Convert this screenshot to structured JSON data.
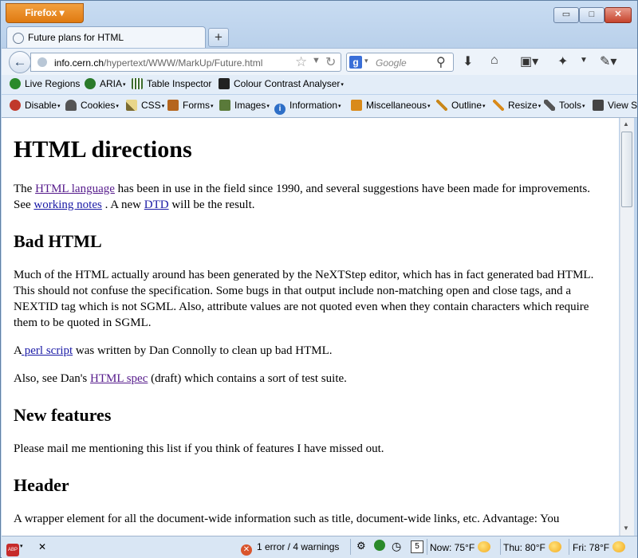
{
  "app": {
    "menu_label": "Firefox"
  },
  "window_controls": {
    "minimize": "▭",
    "maximize": "□",
    "close": "✕"
  },
  "tab": {
    "title": "Future plans for HTML",
    "new_tab": "+"
  },
  "navbar": {
    "url_host": "info.cern.ch",
    "url_path": "/hypertext/WWW/MarkUp/Future.html",
    "search_placeholder": "Google",
    "icons": [
      "back-icon",
      "star-icon",
      "reload-icon",
      "download-icon",
      "home-icon",
      "bookmarks-icon",
      "inspector-icon",
      "eyedropper-icon"
    ]
  },
  "bookmarks": [
    {
      "label": "Live Regions",
      "color": "#2a8a2a"
    },
    {
      "label": "ARIA",
      "color": "#2a7a2a",
      "dropdown": true
    },
    {
      "label": "Table Inspector",
      "color": "#3b6b2b"
    },
    {
      "label": "Colour Contrast Analyser",
      "color": "#222222",
      "dropdown": true
    }
  ],
  "webdev_toolbar": [
    {
      "label": "Disable",
      "color": "#c0392b"
    },
    {
      "label": "Cookies",
      "color": "#555555"
    },
    {
      "label": "CSS",
      "color": "#7a6a30"
    },
    {
      "label": "Forms",
      "color": "#b5651d"
    },
    {
      "label": "Images",
      "color": "#5a7a3a"
    },
    {
      "label": "Information",
      "color": "#2e6fc7"
    },
    {
      "label": "Miscellaneous",
      "color": "#d98a1a"
    },
    {
      "label": "Outline",
      "color": "#c9871a"
    },
    {
      "label": "Resize",
      "color": "#d98a1a"
    },
    {
      "label": "Tools",
      "color": "#555555"
    },
    {
      "label": "View S",
      "color": "#444444"
    }
  ],
  "page": {
    "h1": "HTML directions",
    "intro_1": "The ",
    "intro_link_lang": "HTML language",
    "intro_2": " has been in use in the field since 1990, and several suggestions have been made for improvements. See ",
    "intro_link_notes": "working notes",
    "intro_3": " . A new ",
    "intro_link_dtd": "DTD",
    "intro_4": " will be the result.",
    "h2_bad": "Bad HTML",
    "bad_p": "Much of the HTML actually around has been generated by the NeXTStep editor, which has in fact generated bad HTML. This should not confuse the specification. Some bugs in that output include non-matching open and close tags, and a NEXTID tag which is not SGML. Also, attribute values are not quoted even when they contain characters which require them to be quoted in SGML.",
    "perl_1": "A",
    "perl_link": " perl script",
    "perl_2": " was written by Dan Connolly to clean up bad HTML.",
    "spec_1": "Also, see Dan's ",
    "spec_link": "HTML spec",
    "spec_2": " (draft) which contains a sort of test suite.",
    "h2_new": "New features",
    "new_p": "Please mail me mentioning this list if you think of features I have missed out.",
    "h2_header": "Header",
    "header_p": "A wrapper element for all the document-wide information such as title, document-wide links, etc. Advantage: You"
  },
  "statusbar": {
    "abp": "ABP",
    "close": "✕",
    "errors": "1 error / 4 warnings",
    "calendar_day": "5",
    "weather_now": "Now: 75°F",
    "weather_thu": "Thu: 80°F",
    "weather_fri": "Fri: 78°F"
  }
}
